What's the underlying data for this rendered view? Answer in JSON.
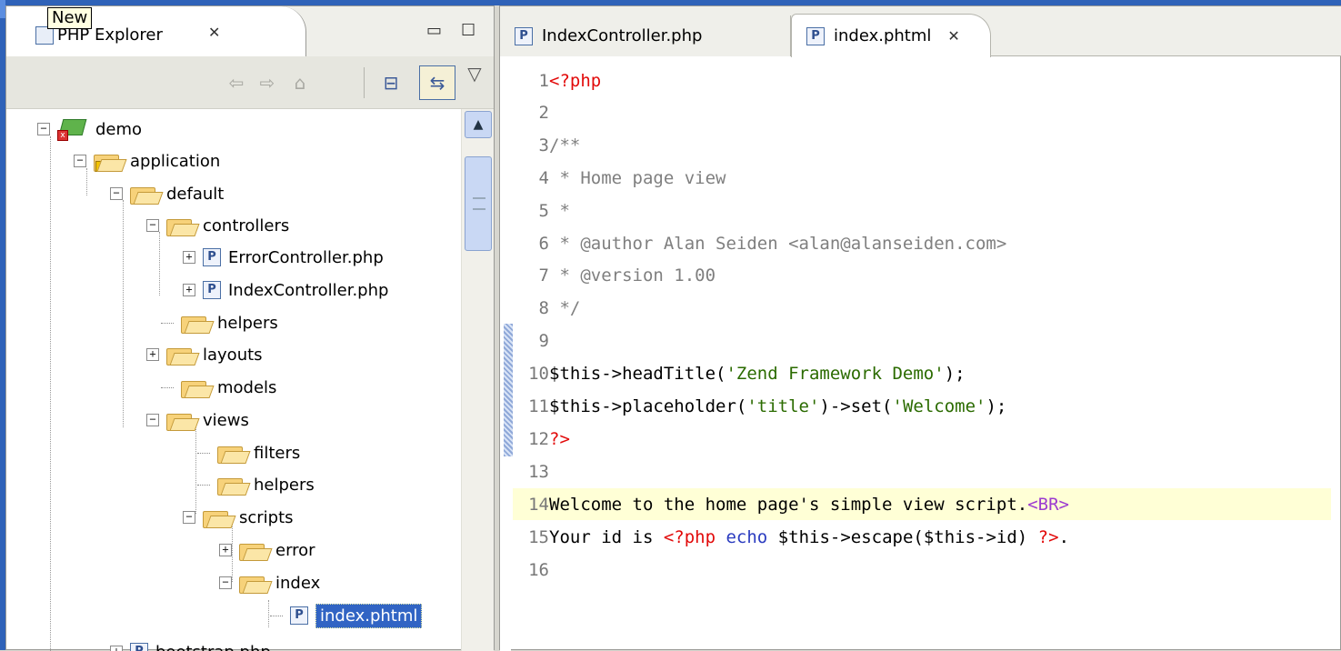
{
  "tooltip": "New",
  "explorer": {
    "title": "PHP Explorer",
    "close": "✕",
    "minimize": "▭",
    "maximize": "☐",
    "toolbar": {
      "back": "⇦",
      "forward": "⇨",
      "home": "⌂",
      "collapse": "⊟",
      "link": "⇆",
      "menu": "▽"
    },
    "tree": [
      {
        "label": "demo"
      },
      {
        "label": "application"
      },
      {
        "label": "default"
      },
      {
        "label": "controllers"
      },
      {
        "label": "ErrorController.php"
      },
      {
        "label": "IndexController.php"
      },
      {
        "label": "helpers"
      },
      {
        "label": "layouts"
      },
      {
        "label": "models"
      },
      {
        "label": "views"
      },
      {
        "label": "filters"
      },
      {
        "label": "helpers"
      },
      {
        "label": "scripts"
      },
      {
        "label": "error"
      },
      {
        "label": "index"
      },
      {
        "label": "index.phtml"
      },
      {
        "label": "bootstrap.php"
      }
    ],
    "scroll_up": "▲"
  },
  "editor": {
    "tabs": [
      {
        "label": "IndexController.php",
        "icon": "P"
      },
      {
        "label": "index.phtml",
        "icon": "P",
        "close": "✕"
      }
    ],
    "lines": [
      {
        "n": "1",
        "t": "<?php"
      },
      {
        "n": "2",
        "t": ""
      },
      {
        "n": "3",
        "t": "/**"
      },
      {
        "n": "4",
        "t": " * Home page view"
      },
      {
        "n": "5",
        "t": " *"
      },
      {
        "n": "6",
        "t": " * @author Alan Seiden <alan@alanseiden.com>"
      },
      {
        "n": "7",
        "t": " * @version 1.00"
      },
      {
        "n": "8",
        "t": " */"
      },
      {
        "n": "9",
        "t": ""
      },
      {
        "n": "10",
        "a": "$this->headTitle(",
        "b": "'Zend Framework Demo'",
        "c": ");"
      },
      {
        "n": "11",
        "a": "$this->placeholder(",
        "b": "'title'",
        "c": ")->set(",
        "d": "'Welcome'",
        "e": ");"
      },
      {
        "n": "12",
        "t": "?>"
      },
      {
        "n": "13",
        "t": ""
      },
      {
        "n": "14",
        "a": "Welcome to the home page's simple view script.",
        "b": "<BR>"
      },
      {
        "n": "15",
        "a": "Your id is ",
        "b": "<?php",
        "c": " echo ",
        "d": "$this->escape($this->id) ",
        "e": "?>",
        "f": "."
      },
      {
        "n": "16",
        "t": ""
      }
    ]
  },
  "icon_names": [
    "php-file-icon",
    "folder-icon",
    "project-icon",
    "close-icon",
    "minimize-icon",
    "maximize-icon"
  ]
}
